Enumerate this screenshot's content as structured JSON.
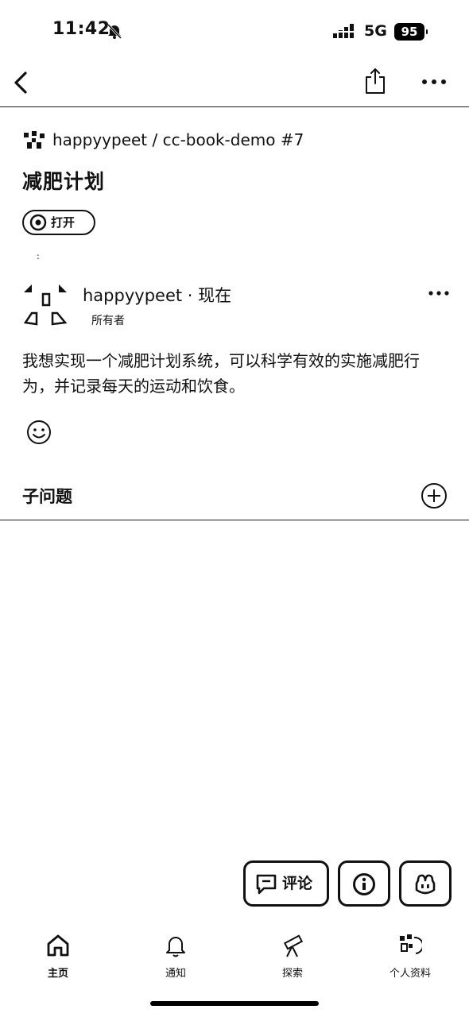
{
  "status_bar": {
    "time": "11:42",
    "network": "5G",
    "battery": "95"
  },
  "repo": {
    "owner": "happyypeet",
    "name": "cc-book-demo",
    "number": "#7",
    "line": "happyypeet / cc-book-demo #7"
  },
  "issue": {
    "title": "减肥计划",
    "state_label": "打开"
  },
  "tiny_mark": ":",
  "comment": {
    "author": "happyypeet",
    "time": "现在",
    "author_line": "happyypeet · 现在",
    "role": "所有者",
    "body": "我想实现一个减肥计划系统，可以科学有效的实施减肥行为，并记录每天的运动和饮食。"
  },
  "sub_issues": {
    "title": "子问题"
  },
  "fab": {
    "comment_label": "评论"
  },
  "tabs": [
    {
      "label": "主页",
      "icon": "home-icon"
    },
    {
      "label": "通知",
      "icon": "bell-icon"
    },
    {
      "label": "探索",
      "icon": "telescope-icon"
    },
    {
      "label": "个人资料",
      "icon": "profile-icon"
    }
  ]
}
